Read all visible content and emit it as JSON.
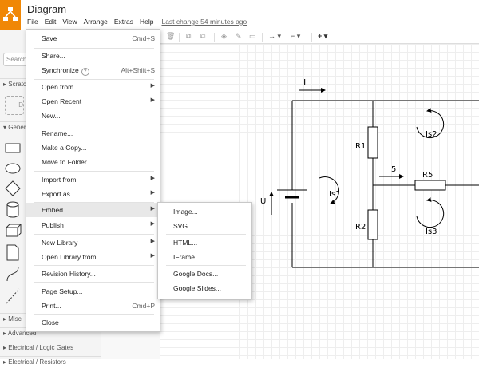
{
  "app": {
    "title": "Diagram",
    "logo_icon": "drawio-logo-icon",
    "brand_color": "#f08705",
    "menubar": [
      "File",
      "Edit",
      "View",
      "Arrange",
      "Extras",
      "Help"
    ],
    "last_change": "Last change 54 minutes ago"
  },
  "sidebar": {
    "search_placeholder": "Search",
    "sections": {
      "scratchpad": "Scratch",
      "general": "General",
      "misc": "Misc",
      "advanced": "Advanced",
      "electrical_logic": "Electrical / Logic Gates",
      "electrical_resistors": "Electrical / Resistors"
    },
    "scratch_box_label": "D"
  },
  "file_menu": {
    "items": [
      {
        "label": "Save",
        "shortcut": "Cmd+S"
      },
      {
        "label": "Share..."
      },
      {
        "label": "Synchronize",
        "shortcut": "Alt+Shift+S",
        "help": "?"
      },
      {
        "label": "Open from"
      },
      {
        "label": "Open Recent"
      },
      {
        "label": "New..."
      },
      {
        "label": "Rename..."
      },
      {
        "label": "Make a Copy..."
      },
      {
        "label": "Move to Folder..."
      },
      {
        "label": "Import from"
      },
      {
        "label": "Export as"
      },
      {
        "label": "Embed"
      },
      {
        "label": "Publish"
      },
      {
        "label": "New Library"
      },
      {
        "label": "Open Library from"
      },
      {
        "label": "Revision History..."
      },
      {
        "label": "Page Setup..."
      },
      {
        "label": "Print...",
        "shortcut": "Cmd+P"
      },
      {
        "label": "Close"
      }
    ]
  },
  "embed_menu": {
    "items": [
      "Image...",
      "SVG...",
      "HTML...",
      "IFrame...",
      "Google Docs...",
      "Google Slides..."
    ]
  },
  "diagram": {
    "labels": {
      "current": "I",
      "voltage": "U",
      "r1": "R1",
      "r2": "R2",
      "r5": "R5",
      "i5": "I5",
      "is1": "Is1",
      "is2": "Is2",
      "is3": "Is3"
    }
  }
}
